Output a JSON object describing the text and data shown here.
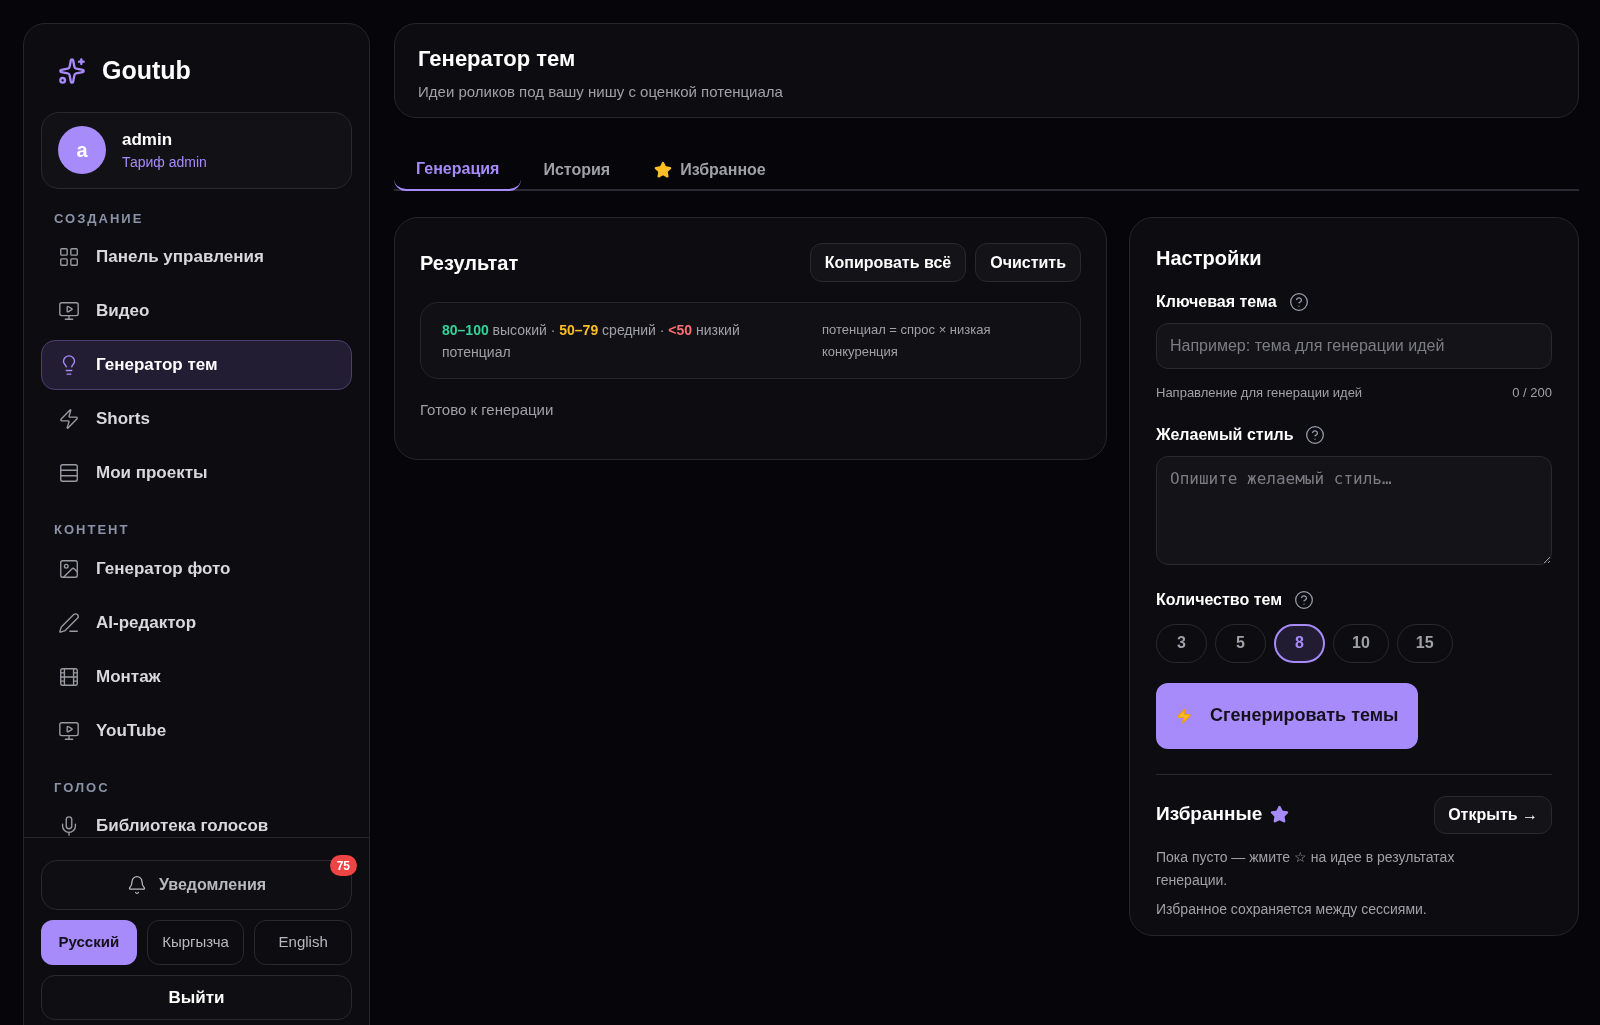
{
  "brand": {
    "name": "Goutub"
  },
  "user": {
    "avatar": "a",
    "name": "admin",
    "plan": "Тариф admin"
  },
  "sidebar": {
    "sections": [
      {
        "title": "СОЗДАНИЕ",
        "items": [
          {
            "label": "Панель управления",
            "kind": "grid",
            "selected": false
          },
          {
            "label": "Видео",
            "kind": "video",
            "selected": false
          },
          {
            "label": "Генератор тем",
            "kind": "bulb",
            "selected": true
          },
          {
            "label": "Shorts",
            "kind": "bolt",
            "selected": false
          },
          {
            "label": "Мои проекты",
            "kind": "list",
            "selected": false
          }
        ]
      },
      {
        "title": "КОНТЕНТ",
        "items": [
          {
            "label": "Генератор фото",
            "kind": "image",
            "selected": false
          },
          {
            "label": "AI-редактор",
            "kind": "pen",
            "selected": false
          },
          {
            "label": "Монтаж",
            "kind": "film",
            "selected": false
          },
          {
            "label": "YouTube",
            "kind": "video",
            "selected": false
          }
        ]
      },
      {
        "title": "ГОЛОС",
        "items": [
          {
            "label": "Библиотека голосов",
            "kind": "mic",
            "selected": false
          }
        ]
      }
    ],
    "notifications": {
      "label": "Уведомления",
      "badge": "75"
    },
    "languages": [
      {
        "label": "Русский",
        "selected": true
      },
      {
        "label": "Кыргызча",
        "selected": false
      },
      {
        "label": "English",
        "selected": false
      }
    ],
    "logout": "Выйти"
  },
  "header": {
    "title": "Генератор тем",
    "subtitle": "Идеи роликов под вашу нишу с оценкой потенциала"
  },
  "tabs": [
    {
      "label": "Генерация",
      "selected": true
    },
    {
      "label": "История",
      "selected": false
    },
    {
      "label": "Избранное",
      "selected": false
    }
  ],
  "result": {
    "title": "Результат",
    "buttons": [
      "Копировать всё",
      "Очистить"
    ],
    "legend": {
      "segments": [
        {
          "text": "80–100",
          "color": "#34d399"
        },
        {
          "text": " высокий · "
        },
        {
          "text": "50–79",
          "color": "#fbbf24"
        },
        {
          "text": " средний · "
        },
        {
          "text": "<50",
          "color": "#f87171"
        },
        {
          "text": " низкий потенциал"
        }
      ],
      "formula": "потенциал = спрос × низкая конкуренция"
    },
    "status": "Готово к генерации"
  },
  "settings": {
    "title": "Настройки",
    "topic": {
      "label": "Ключевая тема",
      "placeholder": "Например: тема для генерации идей",
      "hint": "Направление для генерации идей",
      "counter": "0 / 200"
    },
    "style": {
      "label": "Желаемый стиль",
      "placeholder": "Опишите желаемый стиль…"
    },
    "count": {
      "label": "Количество тем",
      "options": [
        {
          "label": "3",
          "selected": false
        },
        {
          "label": "5",
          "selected": false
        },
        {
          "label": "8",
          "selected": true
        },
        {
          "label": "10",
          "selected": false
        },
        {
          "label": "15",
          "selected": false
        }
      ]
    },
    "generate": "Сгенерировать темы",
    "favorites": {
      "title": "Избранные",
      "open": "Открыть →",
      "empty": "Пока пусто — жмите ☆ на идее в результатах генерации.",
      "note": "Избранное сохраняется между сессиями."
    }
  }
}
